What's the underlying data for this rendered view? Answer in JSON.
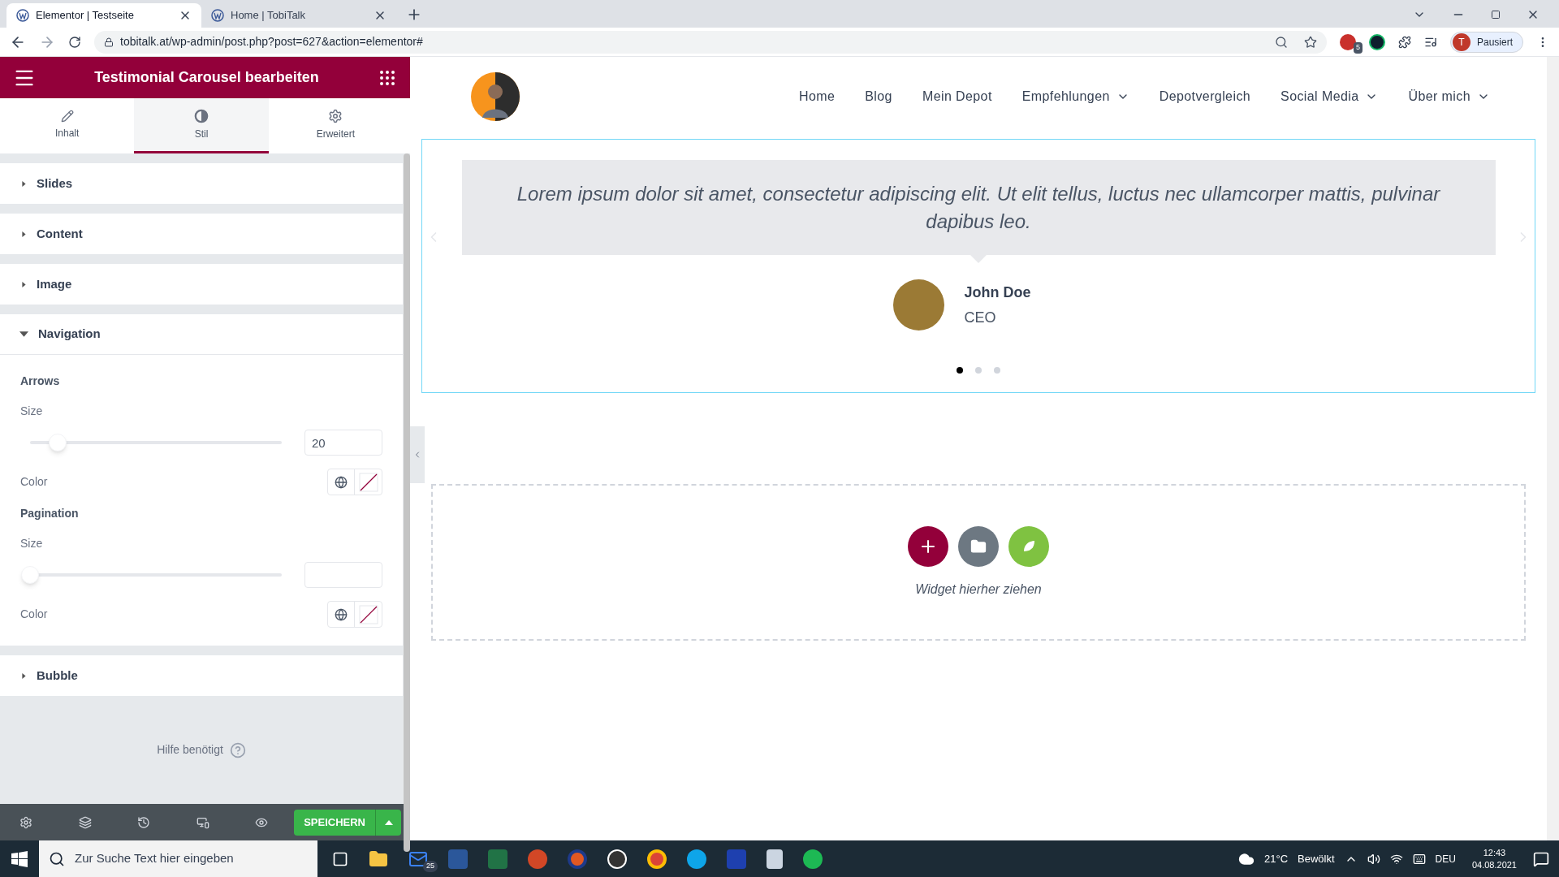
{
  "browser": {
    "tabs": [
      {
        "title": "Elementor | Testseite",
        "selected": true
      },
      {
        "title": "Home | TobiTalk",
        "selected": false
      }
    ],
    "url": "tobitalk.at/wp-admin/post.php?post=627&action=elementor#",
    "extension_badge": "5",
    "profile_initial": "T",
    "profile_label": "Pausiert"
  },
  "panel": {
    "title": "Testimonial Carousel bearbeiten",
    "tabs": [
      {
        "label": "Inhalt",
        "kind": "pencil",
        "selected": false
      },
      {
        "label": "Stil",
        "kind": "contrast",
        "selected": true
      },
      {
        "label": "Erweitert",
        "kind": "gear",
        "selected": false
      }
    ],
    "sections": [
      {
        "title": "Slides",
        "expanded": false
      },
      {
        "title": "Content",
        "expanded": false
      },
      {
        "title": "Image",
        "expanded": false
      },
      {
        "title": "Navigation",
        "expanded": true,
        "groups": [
          {
            "heading": "Arrows",
            "size_label": "Size",
            "level": 0.11,
            "value": "20",
            "color_label": "Color"
          },
          {
            "heading": "Pagination",
            "size_label": "Size",
            "level": 0,
            "color_label": "Color"
          }
        ]
      },
      {
        "title": "Bubble",
        "expanded": false
      }
    ],
    "help": "Hilfe benötigt",
    "save_button": "SPEICHERN"
  },
  "page": {
    "nav": [
      {
        "label": "Home",
        "dropdown": false
      },
      {
        "label": "Blog",
        "dropdown": false
      },
      {
        "label": "Mein Depot",
        "dropdown": false
      },
      {
        "label": "Empfehlungen",
        "dropdown": true
      },
      {
        "label": "Depotvergleich",
        "dropdown": false
      },
      {
        "label": "Social Media",
        "dropdown": true
      },
      {
        "label": "Über mich",
        "dropdown": true
      }
    ],
    "quote": "Lorem ipsum dolor sit amet, consectetur adipiscing elit. Ut elit tellus, luctus nec ullamcorper mattis, pulvinar dapibus leo.",
    "author": "John Doe",
    "author_title": "CEO",
    "dots": [
      {
        "selected": true
      },
      {
        "selected": false
      },
      {
        "selected": false
      }
    ],
    "dropzone_text": "Widget hierher ziehen"
  },
  "taskbar": {
    "search_placeholder": "Zur Suche Text hier eingeben",
    "mail_badge": "25",
    "weather": "21°C",
    "weather_text": "Bewölkt",
    "language": "DEU",
    "time": "12:43",
    "date": "04.08.2021"
  }
}
